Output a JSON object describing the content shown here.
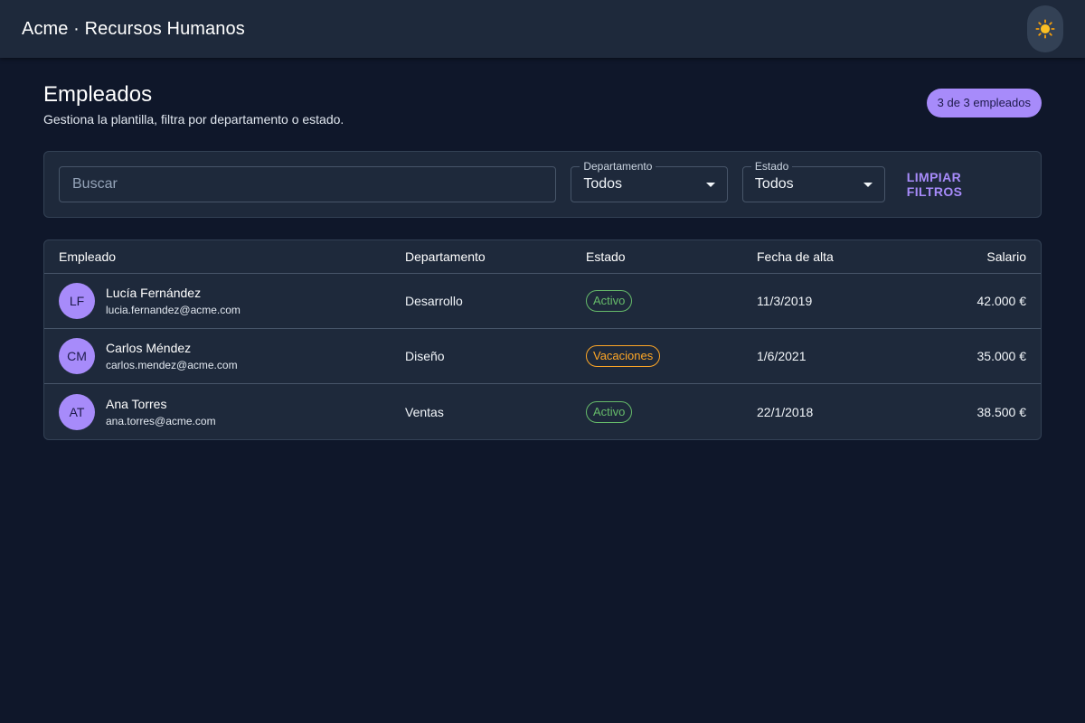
{
  "app": {
    "title": "Acme · Recursos Humanos"
  },
  "page": {
    "title": "Empleados",
    "subtitle": "Gestiona la plantilla, filtra por departamento o estado.",
    "count_label": "3 de 3 empleados"
  },
  "filters": {
    "search_placeholder": "Buscar",
    "search_value": "",
    "department": {
      "label": "Departamento",
      "value": "Todos"
    },
    "status": {
      "label": "Estado",
      "value": "Todos"
    },
    "clear_label": "LIMPIAR FILTROS"
  },
  "table": {
    "headers": [
      "Empleado",
      "Departamento",
      "Estado",
      "Fecha de alta",
      "Salario"
    ],
    "rows": [
      {
        "initials": "LF",
        "name": "Lucía Fernández",
        "email": "lucia.fernandez@acme.com",
        "department": "Desarrollo",
        "status": "Activo",
        "status_color": "#66bb6a",
        "hire_date": "11/3/2019",
        "salary": "42.000 €"
      },
      {
        "initials": "CM",
        "name": "Carlos Méndez",
        "email": "carlos.mendez@acme.com",
        "department": "Diseño",
        "status": "Vacaciones",
        "status_color": "#ffa726",
        "hire_date": "1/6/2021",
        "salary": "35.000 €"
      },
      {
        "initials": "AT",
        "name": "Ana Torres",
        "email": "ana.torres@acme.com",
        "department": "Ventas",
        "status": "Activo",
        "status_color": "#66bb6a",
        "hire_date": "22/1/2018",
        "salary": "38.500 €"
      }
    ]
  },
  "icons": {
    "theme_toggle": "sun-icon"
  },
  "colors": {
    "accent": "#a78bfa",
    "background": "#0f172a",
    "surface": "#1e293b"
  }
}
